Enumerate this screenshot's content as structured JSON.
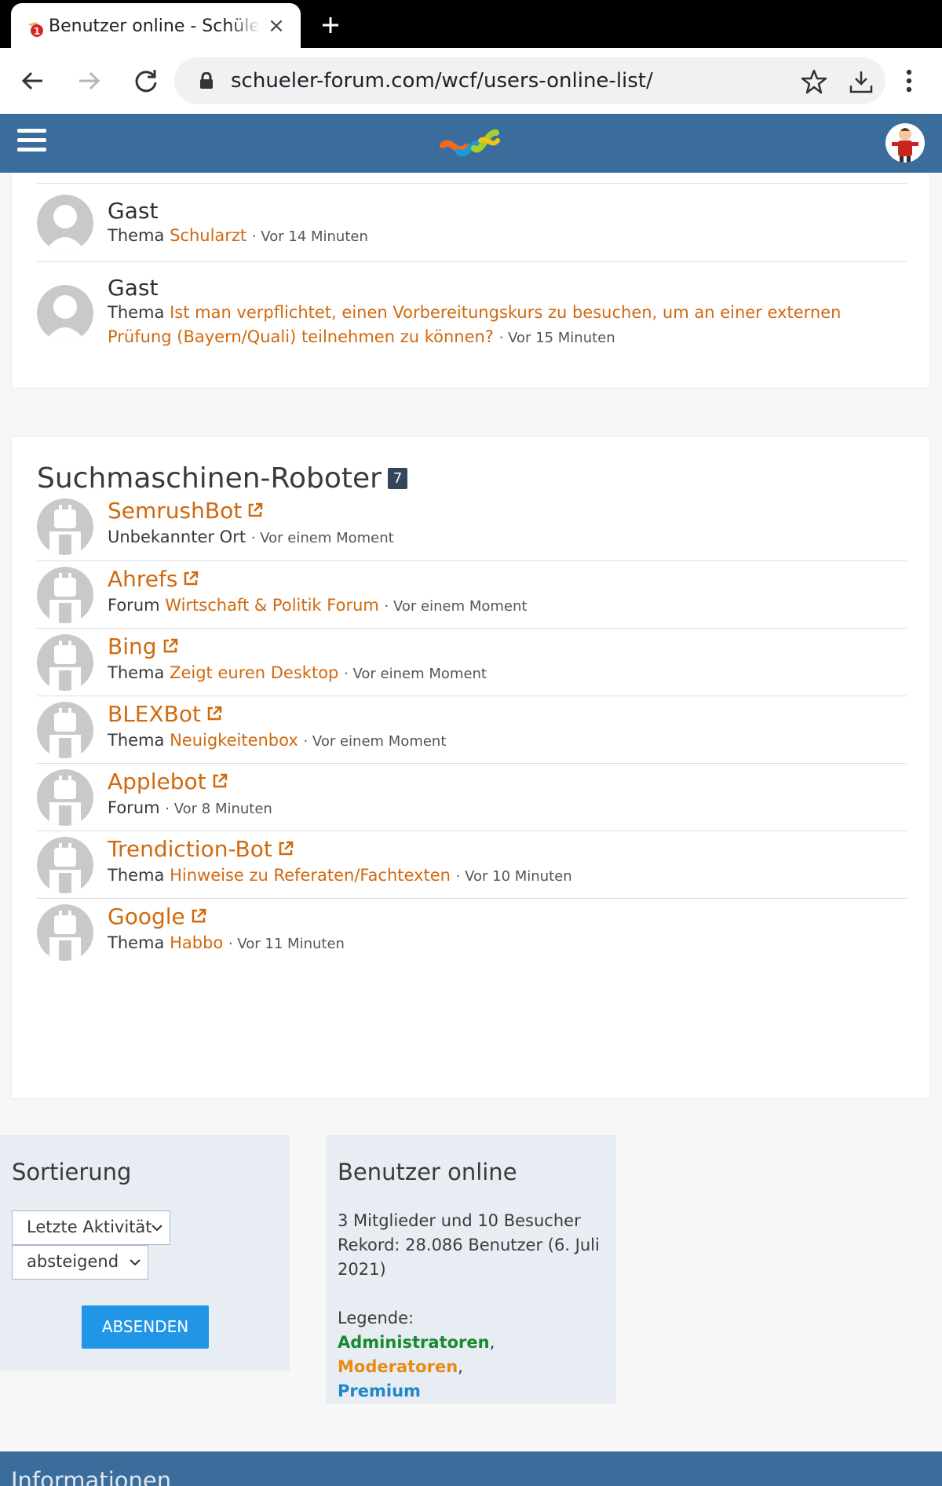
{
  "browser": {
    "tab_title": "Benutzer online - Schülerforum",
    "url": "schueler-forum.com/wcf/users-online-list/"
  },
  "guests": [
    {
      "name": "Gast",
      "prefix": "Thema",
      "link": "Schularzt",
      "time": "· Vor 14 Minuten"
    },
    {
      "name": "Gast",
      "prefix": "Thema",
      "link": "Ist man verpflichtet, einen Vorbereitungskurs zu besuchen, um an einer externen Prüfung (Bayern/Quali) teilnehmen zu können?",
      "time": "· Vor 15 Minuten"
    }
  ],
  "bots_section": {
    "title": "Suchmaschinen-Roboter",
    "count": "7",
    "items": [
      {
        "name": "SemrushBot",
        "prefix": "Unbekannter Ort",
        "link": "",
        "time": "· Vor einem Moment"
      },
      {
        "name": "Ahrefs",
        "prefix": "Forum",
        "link": "Wirtschaft & Politik Forum",
        "time": "· Vor einem Moment"
      },
      {
        "name": "Bing",
        "prefix": "Thema",
        "link": "Zeigt euren Desktop",
        "time": "· Vor einem Moment"
      },
      {
        "name": "BLEXBot",
        "prefix": "Thema",
        "link": "Neuigkeitenbox",
        "time": "· Vor einem Moment"
      },
      {
        "name": "Applebot",
        "prefix": "Forum",
        "link": "",
        "time": "· Vor 8 Minuten"
      },
      {
        "name": "Trendiction-Bot",
        "prefix": "Thema",
        "link": "Hinweise zu Referaten/Fachtexten",
        "time": "· Vor 10 Minuten"
      },
      {
        "name": "Google",
        "prefix": "Thema",
        "link": "Habbo",
        "time": "· Vor 11 Minuten"
      }
    ]
  },
  "sorting": {
    "title": "Sortierung",
    "sort_field": "Letzte Aktivität",
    "sort_order": "absteigend",
    "submit_label": "ABSENDEN"
  },
  "online_box": {
    "title": "Benutzer online",
    "summary": "3 Mitglieder und 10 Besucher",
    "record": "Rekord: 28.086 Benutzer (6. Juli 2021)",
    "legend_label": "Legende:",
    "legend_admin": "Administratoren",
    "legend_mod": "Moderatoren",
    "legend_premium": "Premium",
    "sep": ","
  },
  "footer": {
    "title": "Informationen"
  },
  "colors": {
    "header": "#3a6d9c",
    "link": "#d0690f",
    "button": "#2296e6",
    "admin": "#178a2e",
    "moderator": "#e88a14",
    "premium": "#1e88c8"
  },
  "icons": [
    "favicon-icon",
    "close-icon",
    "plus-icon",
    "back-arrow-icon",
    "forward-arrow-icon",
    "reload-icon",
    "lock-icon",
    "star-icon",
    "download-icon",
    "menu-dots-icon",
    "hamburger-icon",
    "external-link-icon",
    "chevron-down-icon"
  ]
}
